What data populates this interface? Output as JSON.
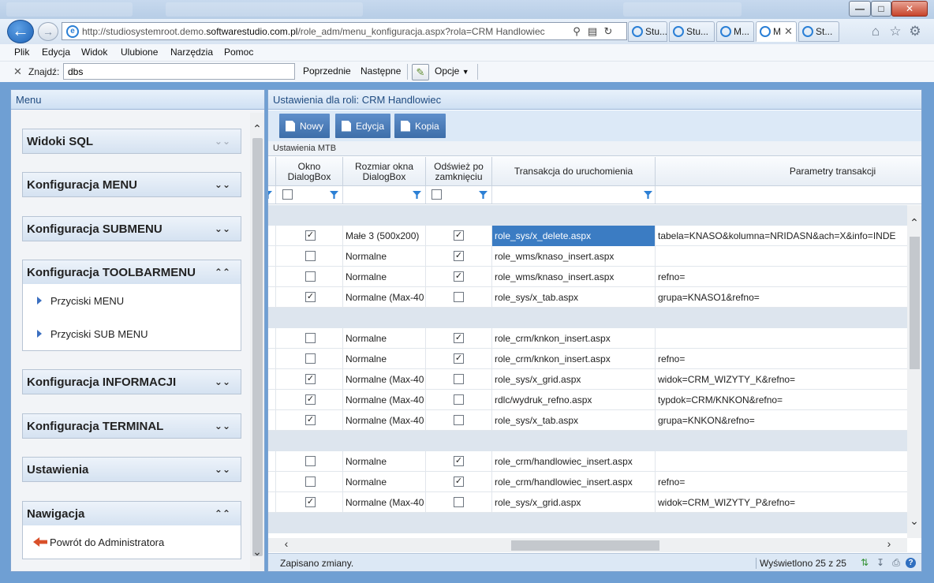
{
  "browser": {
    "url_prefix": "http://studiosystemroot.demo.",
    "url_domain": "softwarestudio.com.pl",
    "url_path": "/role_adm/menu_konfiguracja.aspx?rola=CRM Handlowiec",
    "tabs": [
      {
        "label": "Stu...",
        "active": false
      },
      {
        "label": "Stu...",
        "active": false
      },
      {
        "label": "M...",
        "active": false
      },
      {
        "label": "M",
        "active": true
      },
      {
        "label": "St...",
        "active": false
      }
    ],
    "window_buttons": {
      "minimize": "—",
      "maximize": "□",
      "close": "✕"
    }
  },
  "menubar": [
    "Plik",
    "Edycja",
    "Widok",
    "Ulubione",
    "Narzędzia",
    "Pomoc"
  ],
  "findbar": {
    "label": "Znajdź:",
    "value": "dbs",
    "prev": "Poprzednie",
    "next": "Następne",
    "options": "Opcje"
  },
  "left": {
    "title": "Menu",
    "sections": [
      {
        "title": "Widoki SQL",
        "expanded": false,
        "items": []
      },
      {
        "title": "Konfiguracja MENU",
        "expanded": false,
        "items": []
      },
      {
        "title": "Konfiguracja SUBMENU",
        "expanded": false,
        "items": []
      },
      {
        "title": "Konfiguracja TOOLBARMENU",
        "expanded": true,
        "items": [
          "Przyciski MENU",
          "Przyciski SUB MENU"
        ]
      },
      {
        "title": "Konfiguracja INFORMACJI",
        "expanded": false,
        "items": []
      },
      {
        "title": "Konfiguracja TERMINAL",
        "expanded": false,
        "items": []
      },
      {
        "title": "Ustawienia",
        "expanded": false,
        "items": []
      },
      {
        "title": "Nawigacja",
        "expanded": true,
        "items": [
          "Powrót do Administratora"
        ]
      }
    ]
  },
  "right": {
    "title": "Ustawienia dla roli: CRM Handlowiec",
    "buttons": {
      "new": "Nowy",
      "edit": "Edycja",
      "copy": "Kopia"
    },
    "grid_caption": "Ustawienia MTB",
    "columns": {
      "okno": "Okno DialogBox",
      "rozmiar": "Rozmiar okna DialogBox",
      "odswiez": "Odśwież po zamknięciu",
      "transakcja": "Transakcja do uruchomienia",
      "parametry": "Parametry transakcji"
    },
    "rows": [
      {
        "group": true
      },
      {
        "okno": true,
        "rozmiar": "Małe 3 (500x200)",
        "odswiez": true,
        "transakcja": "role_sys/x_delete.aspx",
        "parametry": "tabela=KNASO&kolumna=NRIDASN&ach=X&info=INDE",
        "selected": true
      },
      {
        "okno": false,
        "rozmiar": "Normalne",
        "odswiez": true,
        "transakcja": "role_wms/knaso_insert.aspx",
        "parametry": ""
      },
      {
        "okno": false,
        "rozmiar": "Normalne",
        "odswiez": true,
        "transakcja": "role_wms/knaso_insert.aspx",
        "parametry": "refno="
      },
      {
        "okno": true,
        "rozmiar": "Normalne (Max-40",
        "odswiez": false,
        "transakcja": "role_sys/x_tab.aspx",
        "parametry": "grupa=KNASO1&refno="
      },
      {
        "group": true
      },
      {
        "okno": false,
        "rozmiar": "Normalne",
        "odswiez": true,
        "transakcja": "role_crm/knkon_insert.aspx",
        "parametry": ""
      },
      {
        "okno": false,
        "rozmiar": "Normalne",
        "odswiez": true,
        "transakcja": "role_crm/knkon_insert.aspx",
        "parametry": "refno="
      },
      {
        "okno": true,
        "rozmiar": "Normalne (Max-40",
        "odswiez": false,
        "transakcja": "role_sys/x_grid.aspx",
        "parametry": "widok=CRM_WIZYTY_K&refno="
      },
      {
        "okno": true,
        "rozmiar": "Normalne (Max-40",
        "odswiez": false,
        "transakcja": "rdlc/wydruk_refno.aspx",
        "parametry": "typdok=CRM/KNKON&refno="
      },
      {
        "okno": true,
        "rozmiar": "Normalne (Max-40",
        "odswiez": false,
        "transakcja": "role_sys/x_tab.aspx",
        "parametry": "grupa=KNKON&refno="
      },
      {
        "group": true
      },
      {
        "okno": false,
        "rozmiar": "Normalne",
        "odswiez": true,
        "transakcja": "role_crm/handlowiec_insert.aspx",
        "parametry": ""
      },
      {
        "okno": false,
        "rozmiar": "Normalne",
        "odswiez": true,
        "transakcja": "role_crm/handlowiec_insert.aspx",
        "parametry": "refno="
      },
      {
        "okno": true,
        "rozmiar": "Normalne (Max-40",
        "odswiez": false,
        "transakcja": "role_sys/x_grid.aspx",
        "parametry": "widok=CRM_WIZYTY_P&refno="
      },
      {
        "group": true
      }
    ],
    "status_message": "Zapisano zmiany.",
    "status_count": "Wyświetlono 25 z 25"
  },
  "colors": {
    "selection": "#3b7cc3",
    "button": "#4f80bd",
    "panel_border": "#7fa3cf",
    "header_text": "#1f4b80"
  }
}
